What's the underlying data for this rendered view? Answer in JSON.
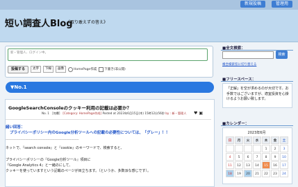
{
  "topbar": {
    "post_label": "新規投稿",
    "admin_label": "管理用"
  },
  "header": {
    "title": "短い調査人Blog",
    "subtitle": "《取り敢えずの答え》"
  },
  "composer": {
    "placeholder": "新・管理人、ログイン中。",
    "submit_label": "投稿する",
    "tools": [
      "太字",
      "下線",
      "画像"
    ],
    "radio_html": "HomePage作成",
    "checkbox_draft": "下書き(非公開)"
  },
  "section": {
    "label": "▼No.1"
  },
  "entry": {
    "title": "GoogleSearchConsoleのクッキー利用の記載は必要か？",
    "meta_no": "No. 1",
    "meta_tag": "［何欄］",
    "meta_category": "[Category: HomePage作成]",
    "meta_posted": "Posted at 2023年6月15日(木) 15時12分56秒",
    "meta_by": "by : 新・管理人",
    "heading": "緒い回答：",
    "subheading": "プライバシーポリシー内のGoogle分析ツールへの記載の必要性については、「グレー」！！",
    "dash": "---------------------------------------------------------------------------",
    "line1": "ネットで、『search console』と『cookie』のキーワードで、検索すると、",
    "line2": "プライバシーポリシーの『Google分析ツール』項目に",
    "line3": "『Google Analytics 4』と一緒のにして、",
    "line4": "クッキーを使っていますという記載のページが目立ちます。（というか、多数派な感じです）。"
  },
  "sidebar": {
    "search_head": "■全文検索：",
    "search_button": "検索",
    "search_link": "複合検索窓に切り替える",
    "free_head": "■フリースペース：",
    "free_text": "「正解」を空が求めるのが大切です。お手数ではございますが、適宜投資を心掛けるようお願い致します。",
    "calendar_head": "■カレンダー：",
    "calendar_title": "2023年6月",
    "weekdays": [
      "日",
      "月",
      "火",
      "水",
      "木",
      "金",
      "土"
    ],
    "days": [
      "",
      "",
      "",
      "",
      "1",
      "2",
      "3",
      "4",
      "5",
      "6",
      "7",
      "8",
      "9",
      "10",
      "11",
      "12",
      "13",
      "14",
      "15",
      "16",
      "17",
      "18",
      "19",
      "20",
      "21",
      "22",
      "23",
      "24",
      "25",
      "26",
      "27",
      "28",
      "29",
      "30",
      ""
    ]
  }
}
